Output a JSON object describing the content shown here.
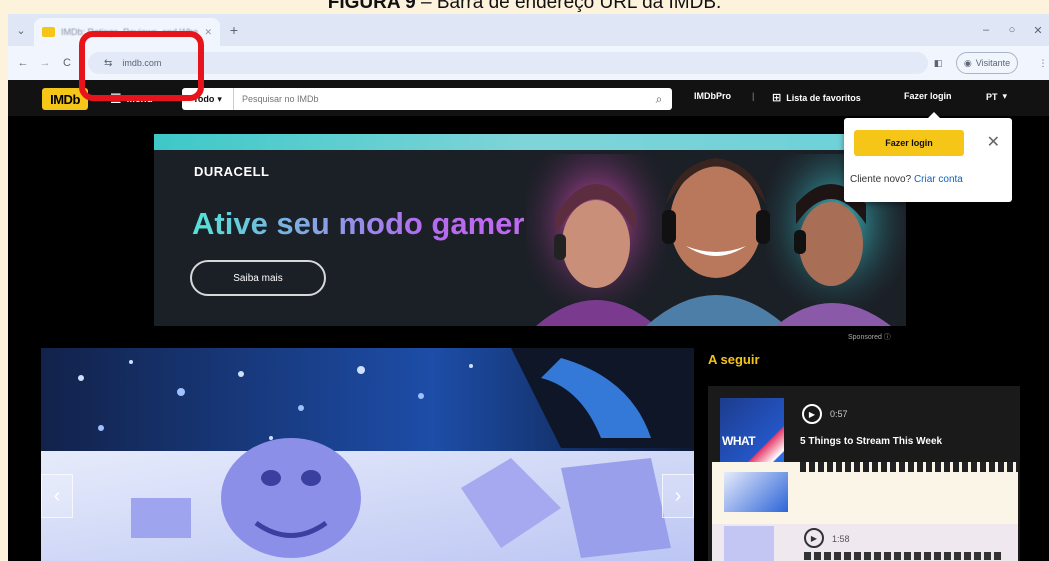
{
  "caption": {
    "label": "FIGURA 9",
    "text": "– Barra de endereço URL da IMDB."
  },
  "browser": {
    "tab_title": "IMDb: Ratings, Reviews, and Where",
    "url": "imdb.com",
    "guest_label": "Visitante"
  },
  "imdb": {
    "logo": "IMDb",
    "menu_label": "Menu",
    "search_category": "Todo",
    "search_placeholder": "Pesquisar no IMDb",
    "imdbpro": "IMDbPro",
    "watchlist": "Lista de favoritos",
    "signin": "Fazer login",
    "language": "PT"
  },
  "signin_popup": {
    "button": "Fazer login",
    "new_customer": "Cliente novo?",
    "create_account": "Criar conta"
  },
  "ad": {
    "brand": "DURACELL",
    "headline": "Ative seu modo gamer",
    "cta": "Saiba mais",
    "sponsored": "Sponsored ⓘ"
  },
  "up_next": {
    "heading": "A seguir",
    "items": [
      {
        "duration": "0:57",
        "title": "5 Things to Stream This Week",
        "thumb_text": "WHAT"
      },
      {
        "duration": "1:58"
      }
    ]
  },
  "colors": {
    "imdb_yellow": "#f5c518",
    "highlight_red": "#e8141b",
    "link_blue": "#0e63be"
  }
}
